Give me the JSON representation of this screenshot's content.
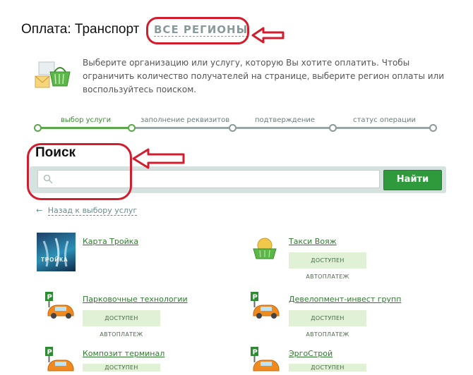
{
  "header": {
    "title": "Оплата: Транспорт",
    "regions_link": "ВСЕ РЕГИОНЫ",
    "description": "Выберите организацию или услугу, которую Вы хотите оплатить. Чтобы ограничить количество получателей на странице, выберите регион оплаты или воспользуйтесь поиском."
  },
  "steps": [
    {
      "label": "выбор услуги",
      "active": true
    },
    {
      "label": "заполнение реквизитов",
      "active": false
    },
    {
      "label": "подтверждение",
      "active": false
    },
    {
      "label": "статус операции",
      "active": false
    }
  ],
  "search": {
    "title": "Поиск",
    "placeholder": "",
    "button_label": "Найти"
  },
  "back_link": "Назад к выбору услуг",
  "organizations": [
    {
      "name": "Карта Тройка",
      "autopay": "",
      "logo": "troika-card-logo"
    },
    {
      "name": "Такси Вояж",
      "autopay": "ДОСТУПЕН АВТОПЛАТЕЖ",
      "logo": "basket-icon"
    },
    {
      "name": "Парковочные технологии",
      "autopay": "ДОСТУПЕН АВТОПЛАТЕЖ",
      "logo": "parking-car-icon"
    },
    {
      "name": "Девелопмент-инвест групп",
      "autopay": "ДОСТУПЕН АВТОПЛАТЕЖ",
      "logo": "parking-car-icon"
    },
    {
      "name": "Композит терминал",
      "autopay": "ДОСТУПЕН АВТОПЛАТЕЖ",
      "logo": "parking-car-icon"
    },
    {
      "name": "ЭргоСтрой",
      "autopay": "ДОСТУПЕН АВТОПЛАТЕЖ",
      "logo": "parking-car-icon"
    }
  ],
  "troika_logo_text": "ТРОЙКА",
  "colors": {
    "accent_green": "#2f9a3c",
    "annotation_red": "#d21d2e",
    "step_active": "#5aa84a",
    "step_inactive": "#8d9a9a"
  }
}
